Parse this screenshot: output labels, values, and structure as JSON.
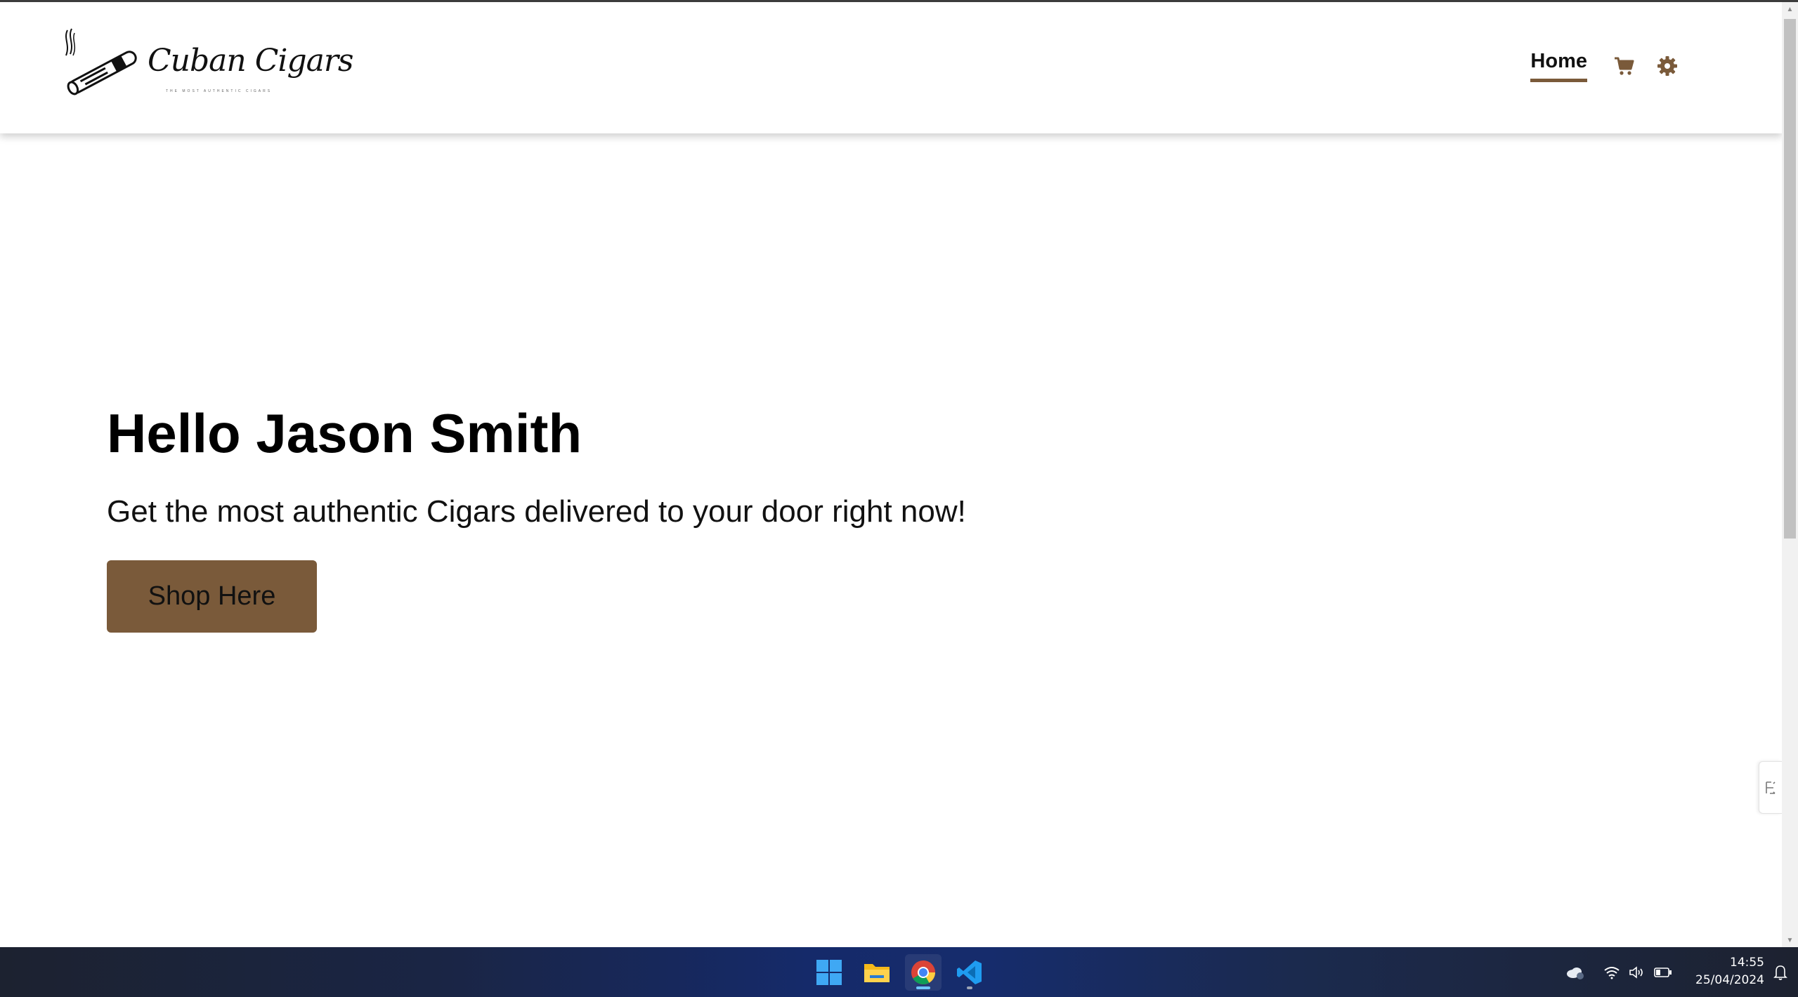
{
  "site": {
    "logo_text": "Cuban Cigars",
    "logo_tagline": "THE MOST AUTHENTIC CIGARS"
  },
  "nav": {
    "home_label": "Home",
    "cart_icon": "cart-icon",
    "settings_icon": "gear-icon"
  },
  "hero": {
    "title": "Hello Jason Smith",
    "subtitle": "Get the most authentic Cigars delivered to your door right now!",
    "button_label": "Shop Here"
  },
  "colors": {
    "accent": "#7a5a3a",
    "text": "#111111",
    "header_bg": "#ffffff"
  },
  "taskbar": {
    "apps": [
      "start-icon",
      "file-explorer-icon",
      "chrome-icon",
      "vscode-icon"
    ],
    "time": "14:55",
    "date": "25/04/2024"
  }
}
